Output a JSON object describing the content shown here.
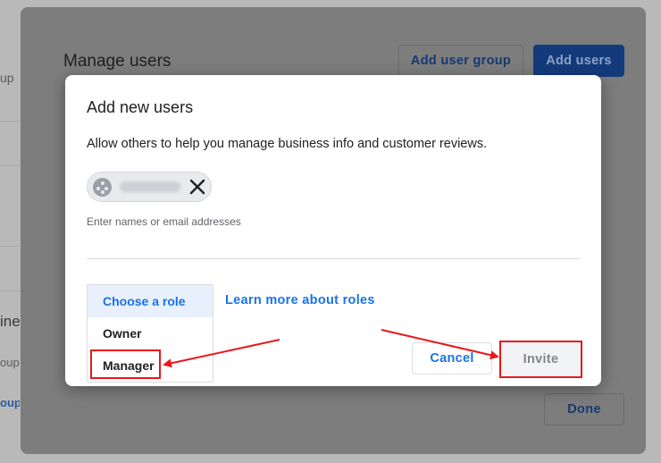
{
  "background": {
    "left_fragments": [
      {
        "text": "up",
        "style": "normal"
      },
      {
        "text": "ine",
        "style": "heading"
      },
      {
        "text": "oup,",
        "style": "normal"
      },
      {
        "text": "oup",
        "style": "link"
      }
    ]
  },
  "manage_users": {
    "title": "Manage users",
    "add_user_group_label": "Add user group",
    "add_users_label": "Add users",
    "done_label": "Done"
  },
  "dialog": {
    "title": "Add new users",
    "description": "Allow others to help you manage business info and customer reviews.",
    "chip": {
      "avatar_icon": "person-avatar-icon",
      "close_icon": "close-icon"
    },
    "input_placeholder": "Enter names or email addresses",
    "role_menu": {
      "items": [
        {
          "label": "Choose a role",
          "selected": true
        },
        {
          "label": "Owner",
          "selected": false
        },
        {
          "label": "Manager",
          "selected": false,
          "highlighted": true
        }
      ]
    },
    "learn_more_label": "Learn more about roles",
    "cancel_label": "Cancel",
    "invite_label": "Invite"
  },
  "colors": {
    "accent": "#1a73e8",
    "annotation_red": "#e8181b",
    "overlay": "#7d7d7d"
  }
}
